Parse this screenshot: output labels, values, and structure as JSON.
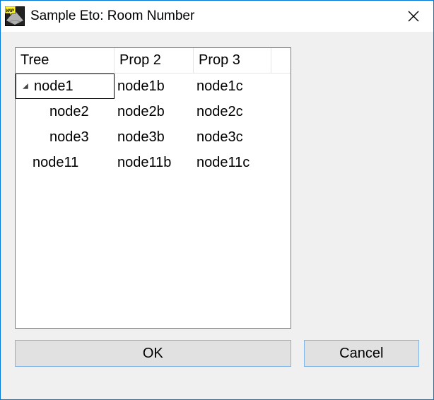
{
  "title": "Sample Eto: Room Number",
  "columns": {
    "tree": "Tree",
    "prop2": "Prop 2",
    "prop3": "Prop 3"
  },
  "rows": [
    {
      "tree": "node1",
      "prop2": "node1b",
      "prop3": "node1c",
      "expanded": true,
      "selected": true,
      "indent": 0
    },
    {
      "tree": "node2",
      "prop2": "node2b",
      "prop3": "node2c",
      "expanded": false,
      "selected": false,
      "indent": 1
    },
    {
      "tree": "node3",
      "prop2": "node3b",
      "prop3": "node3c",
      "expanded": false,
      "selected": false,
      "indent": 1
    },
    {
      "tree": "node11",
      "prop2": "node11b",
      "prop3": "node11c",
      "expanded": false,
      "selected": false,
      "indent": 0
    }
  ],
  "buttons": {
    "ok": "OK",
    "cancel": "Cancel"
  }
}
